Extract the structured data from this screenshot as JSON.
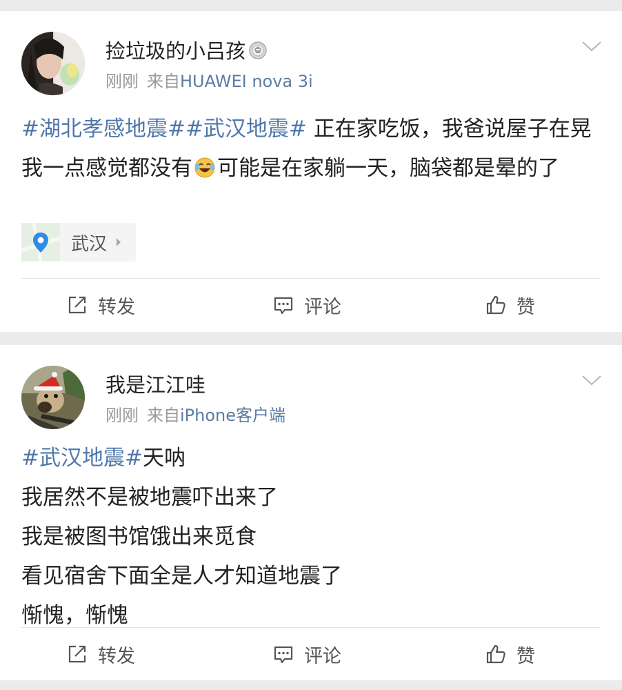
{
  "posts": [
    {
      "username": "捡垃圾的小吕孩",
      "badge_icon": "vip-medal-icon",
      "time": "刚刚",
      "from_prefix": "来自",
      "device": "HUAWEI nova 3i",
      "content": {
        "topic1": "#湖北孝感地震#",
        "topic2": "#武汉地震#",
        "text_a": " 正在家吃饭，我爸说屋子在晃 我一点感觉都没有",
        "emoji": "laughing-crying-emoji",
        "text_b": "可能是在家躺一天，脑袋都是晕的了"
      },
      "location": "武汉",
      "actions": {
        "repost": "转发",
        "comment": "评论",
        "like": "赞"
      }
    },
    {
      "username": "我是江江哇",
      "time": "刚刚",
      "from_prefix": "来自",
      "device": "iPhone客户端",
      "content": {
        "topic1": "#武汉地震#",
        "line1_rest": "天呐",
        "line2": "我居然不是被地震吓出来了",
        "line3": "我是被图书馆饿出来觅食",
        "line4": "看见宿舍下面全是人才知道地震了",
        "line5": "惭愧，惭愧"
      },
      "actions": {
        "repost": "转发",
        "comment": "评论",
        "like": "赞"
      }
    }
  ],
  "colors": {
    "topic_link": "#4f77ab",
    "device_link": "#5b7ba3",
    "meta_gray": "#9a9a9a",
    "background": "#ebebeb"
  }
}
